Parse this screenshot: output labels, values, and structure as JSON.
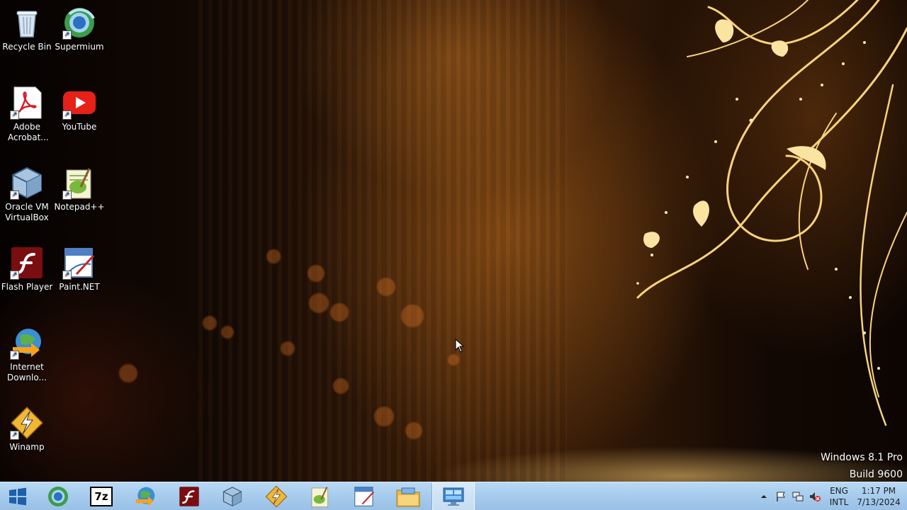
{
  "desktop_icons": [
    {
      "label": "Recycle Bin",
      "icon": "recycle-bin-icon",
      "shortcut": false
    },
    {
      "label": "Supermium",
      "icon": "supermium-browser-icon",
      "shortcut": true
    },
    {
      "label": "Adobe Acrobat...",
      "icon": "adobe-acrobat-icon",
      "shortcut": true
    },
    {
      "label": "YouTube",
      "icon": "youtube-icon",
      "shortcut": true
    },
    {
      "label": "Oracle VM VirtualBox",
      "icon": "virtualbox-icon",
      "shortcut": true
    },
    {
      "label": "Notepad++",
      "icon": "notepad-plus-plus-icon",
      "shortcut": true
    },
    {
      "label": "Flash Player",
      "icon": "flash-player-icon",
      "shortcut": true
    },
    {
      "label": "Paint.NET",
      "icon": "paint-net-icon",
      "shortcut": true
    },
    {
      "label": "Internet Downlo...",
      "icon": "internet-download-manager-icon",
      "shortcut": true
    },
    {
      "label": "Winamp",
      "icon": "winamp-icon",
      "shortcut": true
    }
  ],
  "watermark": {
    "edition": "Windows 8.1 Pro",
    "build": "Build 9600"
  },
  "taskbar": {
    "start_icon": "windows-start-icon",
    "pinned": [
      {
        "name": "supermium-browser-icon"
      },
      {
        "name": "7zip-icon",
        "text": "7z"
      },
      {
        "name": "internet-download-manager-icon"
      },
      {
        "name": "flash-player-icon"
      },
      {
        "name": "virtualbox-icon"
      },
      {
        "name": "winamp-icon"
      },
      {
        "name": "notepad-plus-plus-icon"
      },
      {
        "name": "paint-net-icon"
      },
      {
        "name": "file-explorer-icon"
      },
      {
        "name": "remote-desktop-icon",
        "active": true
      }
    ],
    "tray": {
      "icons": [
        "show-hidden-icons-chevron",
        "action-center-flag-icon",
        "network-icon",
        "volume-muted-icon"
      ],
      "language_top": "ENG",
      "language_bottom": "INTL",
      "time": "1:17 PM",
      "date": "7/13/2024"
    }
  },
  "colors": {
    "taskbar": "#a6cbed",
    "wallpaper_gold": "#f2c46a",
    "wallpaper_dark": "#120804"
  }
}
